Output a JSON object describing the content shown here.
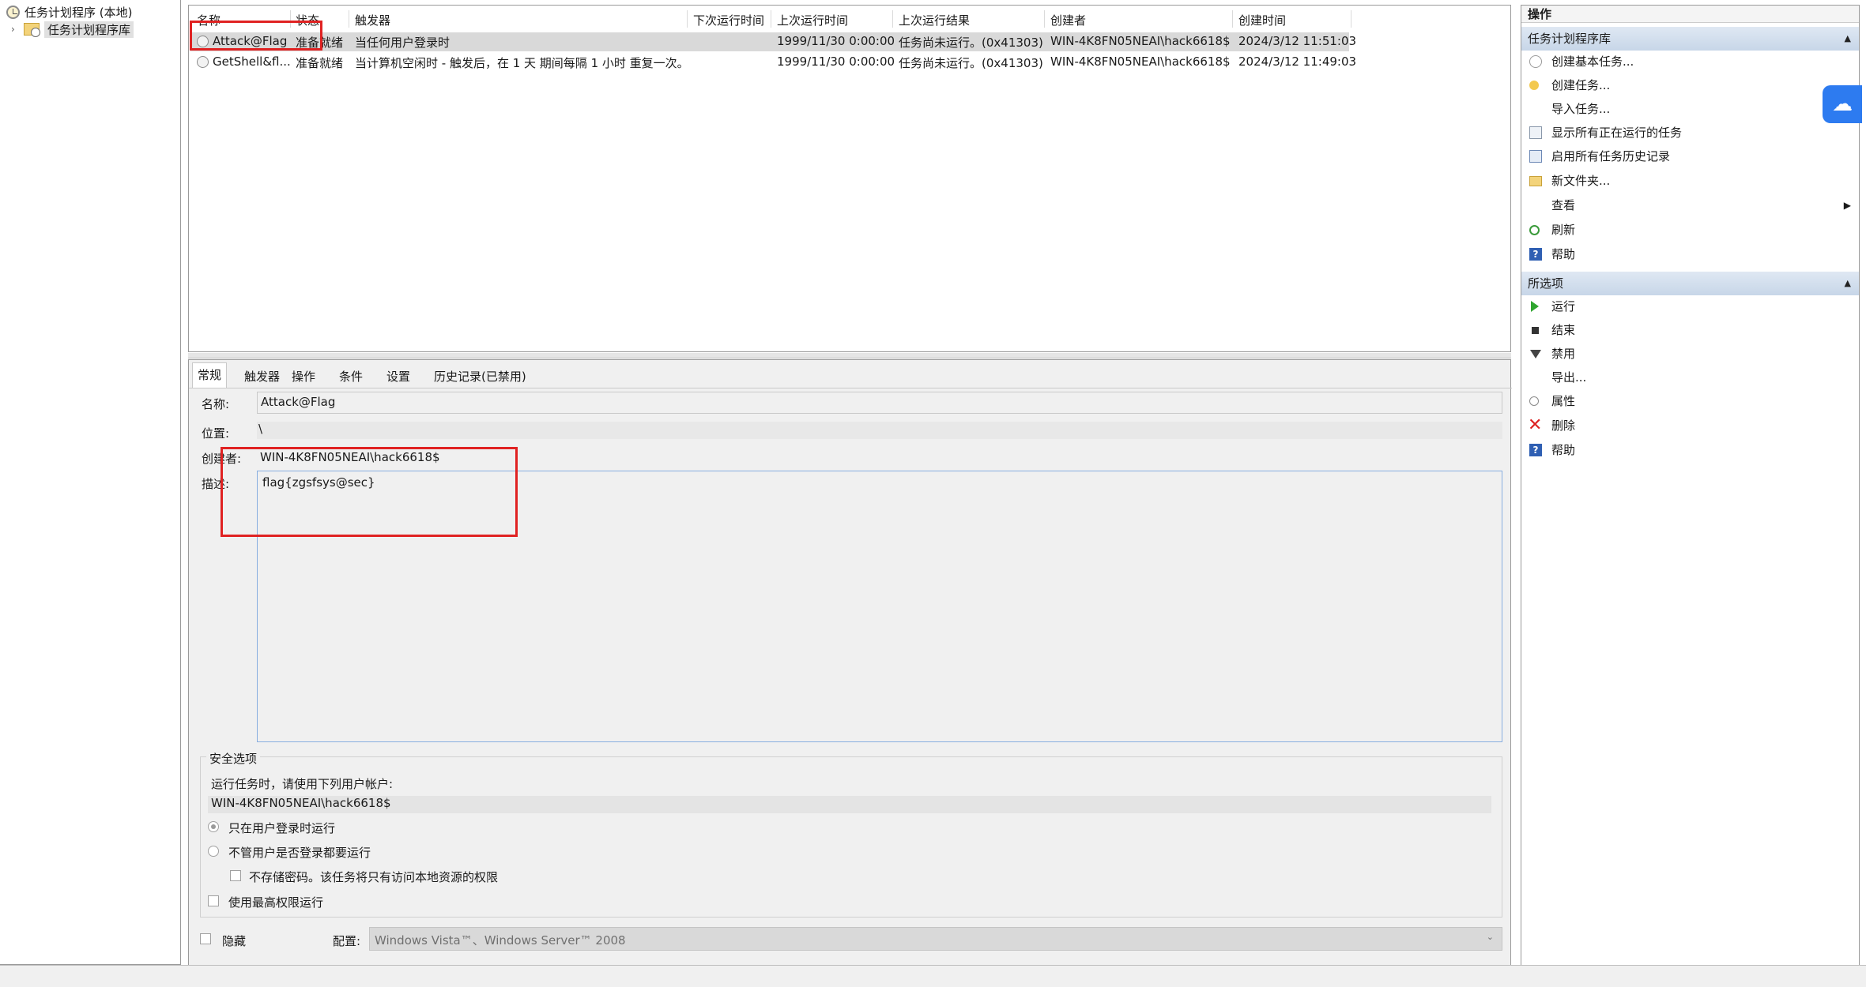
{
  "tree": {
    "root_label": "任务计划程序 (本地)",
    "library_label": "任务计划程序库"
  },
  "tasklist": {
    "columns": [
      "名称",
      "状态",
      "触发器",
      "下次运行时间",
      "上次运行时间",
      "上次运行结果",
      "创建者",
      "创建时间"
    ],
    "rows": [
      {
        "name": "Attack@Flag",
        "status": "准备就绪",
        "trigger": "当任何用户登录时",
        "next_run": "",
        "last_run": "1999/11/30 0:00:00",
        "last_result": "任务尚未运行。(0x41303)",
        "author": "WIN-4K8FN05NEAI\\hack6618$",
        "created": "2024/3/12 11:51:03"
      },
      {
        "name": "GetShell&fl...",
        "status": "准备就绪",
        "trigger": "当计算机空闲时 - 触发后，在 1 天 期间每隔 1 小时 重复一次。",
        "next_run": "",
        "last_run": "1999/11/30 0:00:00",
        "last_result": "任务尚未运行。(0x41303)",
        "author": "WIN-4K8FN05NEAI\\hack6618$",
        "created": "2024/3/12 11:49:03"
      }
    ]
  },
  "detail": {
    "tabs": [
      "常规",
      "触发器",
      "操作",
      "条件",
      "设置",
      "历史记录(已禁用)"
    ],
    "name_label": "名称:",
    "name_value": "Attack@Flag",
    "location_label": "位置:",
    "location_value": "\\",
    "author_label": "创建者:",
    "author_value": "WIN-4K8FN05NEAI\\hack6618$",
    "description_label": "描述:",
    "description_value": "flag{zgsfsys@sec}",
    "security": {
      "group_label": "安全选项",
      "account_prompt": "运行任务时，请使用下列用户帐户:",
      "account_value": "WIN-4K8FN05NEAI\\hack6618$",
      "radio_logged_on": "只在用户登录时运行",
      "radio_any": "不管用户是否登录都要运行",
      "no_store_password": "不存储密码。该任务将只有访问本地资源的权限",
      "highest_privileges": "使用最高权限运行"
    },
    "hidden_label": "隐藏",
    "config_label": "配置:",
    "config_value": "Windows Vista™、Windows Server™ 2008"
  },
  "actions": {
    "title": "操作",
    "section1": "任务计划程序库",
    "items1": [
      {
        "label": "创建基本任务...",
        "icon": "create-basic-task-icon"
      },
      {
        "label": "创建任务...",
        "icon": "create-task-icon"
      },
      {
        "label": "导入任务...",
        "icon": ""
      },
      {
        "label": "显示所有正在运行的任务",
        "icon": "running-tasks-icon"
      },
      {
        "label": "启用所有任务历史记录",
        "icon": "history-icon"
      },
      {
        "label": "新文件夹...",
        "icon": "folder-icon"
      },
      {
        "label": "查看",
        "icon": ""
      },
      {
        "label": "刷新",
        "icon": "refresh-icon"
      },
      {
        "label": "帮助",
        "icon": "help-icon"
      }
    ],
    "section2": "所选项",
    "items2": [
      {
        "label": "运行",
        "icon": "run-icon"
      },
      {
        "label": "结束",
        "icon": "stop-icon"
      },
      {
        "label": "禁用",
        "icon": "disable-icon"
      },
      {
        "label": "导出...",
        "icon": ""
      },
      {
        "label": "属性",
        "icon": "properties-icon"
      },
      {
        "label": "删除",
        "icon": "delete-icon"
      },
      {
        "label": "帮助",
        "icon": "help-icon"
      }
    ]
  },
  "colors": {
    "annotation_red": "#e02222",
    "section_blue": "#c7d6e8",
    "cloud_blue": "#2d7bf0"
  }
}
